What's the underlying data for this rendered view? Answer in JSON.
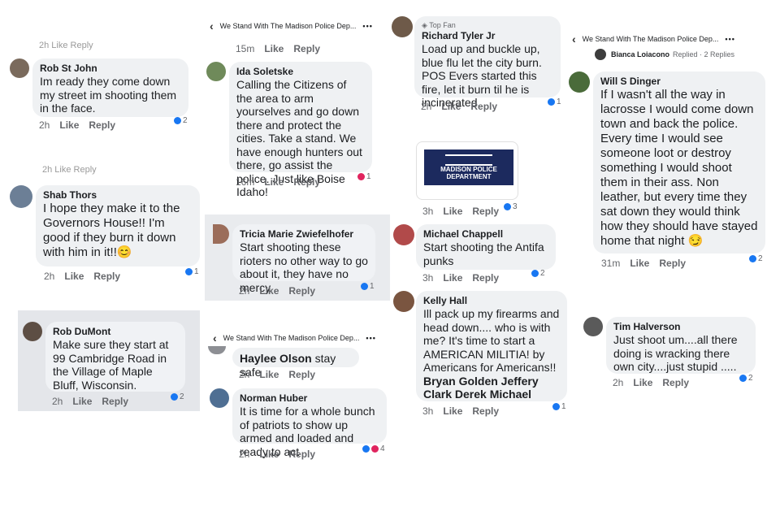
{
  "header": {
    "page_name": "We Stand With The Madison Police Dep...",
    "more": "•••"
  },
  "actions": {
    "like": "Like",
    "reply": "Reply"
  },
  "top_fan": "Top Fan",
  "replied": {
    "name": "Bianca Loiacono",
    "text": "Replied · 2 Replies"
  },
  "police_image_text": "MADISON POLICE DEPARTMENT",
  "comments": {
    "rob_st_john": {
      "name": "Rob St John",
      "text": "Im ready they come down my street im shooting them in the face.",
      "time": "2h",
      "reactions": "2"
    },
    "shab_thors": {
      "name": "Shab Thors",
      "text": "I hope they make it to the Governors House!! I'm good if they burn it down with him in it!!😊",
      "time": "2h",
      "reactions": "1"
    },
    "rob_dumont": {
      "name": "Rob DuMont",
      "text": "Make sure they start at 99 Cambridge Road in the Village of Maple Bluff, Wisconsin.",
      "time": "2h",
      "reactions": "2"
    },
    "ida_soletske": {
      "name": "Ida Soletske",
      "text": "Calling the Citizens of the area to arm yourselves and go down there and protect the cities. Take a stand. We have enough hunters out there, go assist the police. Just like Boise Idaho!",
      "time": "16m",
      "reactions": "1"
    },
    "tricia": {
      "name": "Tricia Marie Zwiefelhofer",
      "text": "Start shooting these rioters no other way to go about it, they have no mercy",
      "time": "2h",
      "reactions": "1"
    },
    "haylee": {
      "name": "Haylee Olson",
      "text": "stay safe",
      "time": "2h"
    },
    "norman": {
      "name": "Norman Huber",
      "text": "It is time for a whole bunch of patriots to show up armed and loaded and ready to act",
      "time": "2h",
      "reactions": "4"
    },
    "richard": {
      "name": "Richard Tyler Jr",
      "text": "Load up and buckle up, blue flu let the city burn.  POS Evers started this fire, let it burn til he is incinerated.",
      "time": "2h",
      "reactions": "1"
    },
    "image_post": {
      "time": "3h",
      "reactions": "3"
    },
    "michael": {
      "name": "Michael Chappell",
      "text": "Start shooting the Antifa punks",
      "time": "3h",
      "reactions": "2"
    },
    "kelly": {
      "name": "Kelly Hall",
      "text": "Ill pack up my firearms and head down.... who is with me? It's time to start a AMERICAN MILITIA! by Americans for Americans!!",
      "tags": "Bryan Golden Jeffery Clark Derek Michael",
      "time": "3h",
      "reactions": "1"
    },
    "will": {
      "name": "Will S Dinger",
      "text": "If I wasn't all the way in lacrosse I would come down town and back the police. Every time I would see someone loot or destroy something I would shoot them in their ass. Non leather, but every time they sat down they would think how they should have stayed home that night 😏",
      "time": "31m",
      "reactions": "2"
    },
    "tim": {
      "name": "Tim Halverson",
      "text": "Just shoot um....all there doing is wracking there own city....just stupid .....",
      "time": "2h",
      "reactions": "2"
    }
  },
  "cut_meta": {
    "a": "2h  Like  Reply",
    "b": "2h  Like  Reply",
    "c": "15m",
    "d": "2h  Like  Reply"
  }
}
